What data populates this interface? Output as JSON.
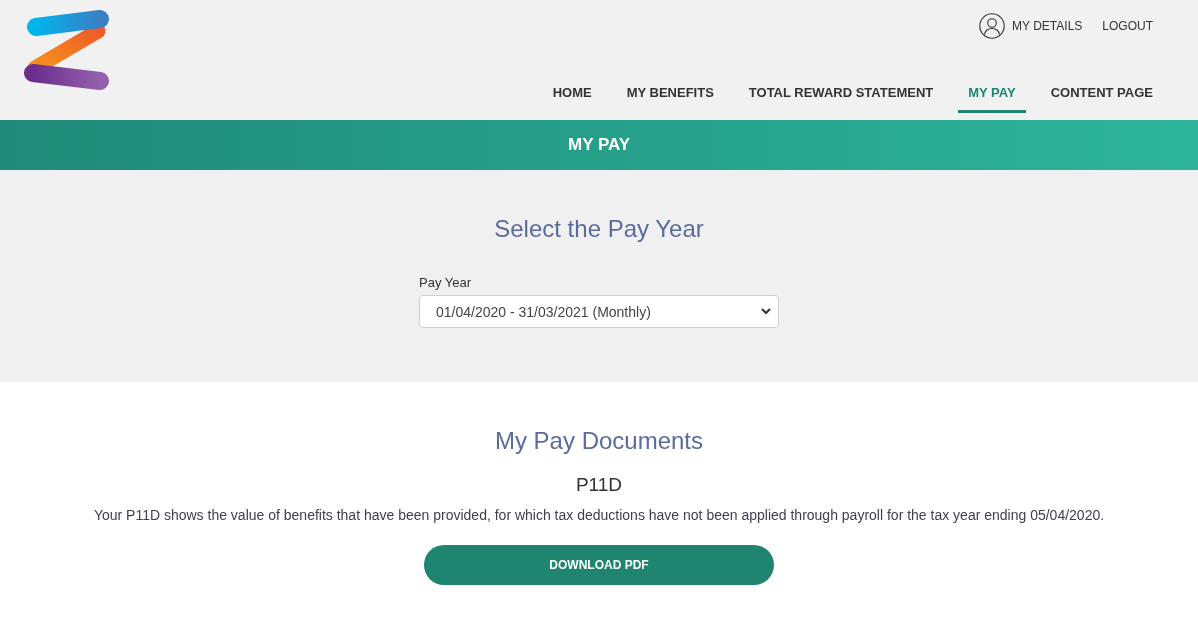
{
  "user_menu": [
    {
      "label": "MY DETAILS",
      "kind": "profile"
    },
    {
      "label": "LOGOUT",
      "kind": "plain"
    }
  ],
  "nav": [
    {
      "label": "HOME",
      "selected": false
    },
    {
      "label": "MY BENEFITS",
      "selected": false
    },
    {
      "label": "TOTAL REWARD STATEMENT",
      "selected": false
    },
    {
      "label": "MY PAY",
      "selected": true
    },
    {
      "label": "CONTENT PAGE",
      "selected": false
    }
  ],
  "banner": {
    "title": "MY PAY"
  },
  "pay_year_section": {
    "heading": "Select the Pay Year",
    "field_label": "Pay Year",
    "value": "01/04/2020 - 31/03/2021 (Monthly)"
  },
  "documents_section": {
    "heading": "My Pay Documents",
    "documents": [
      {
        "title": "P11D",
        "description": "Your P11D shows the value of benefits that have been provided, for which tax deductions have not been applied through payroll for the tax year ending 05/04/2020.",
        "button": "DOWNLOAD PDF"
      }
    ]
  }
}
